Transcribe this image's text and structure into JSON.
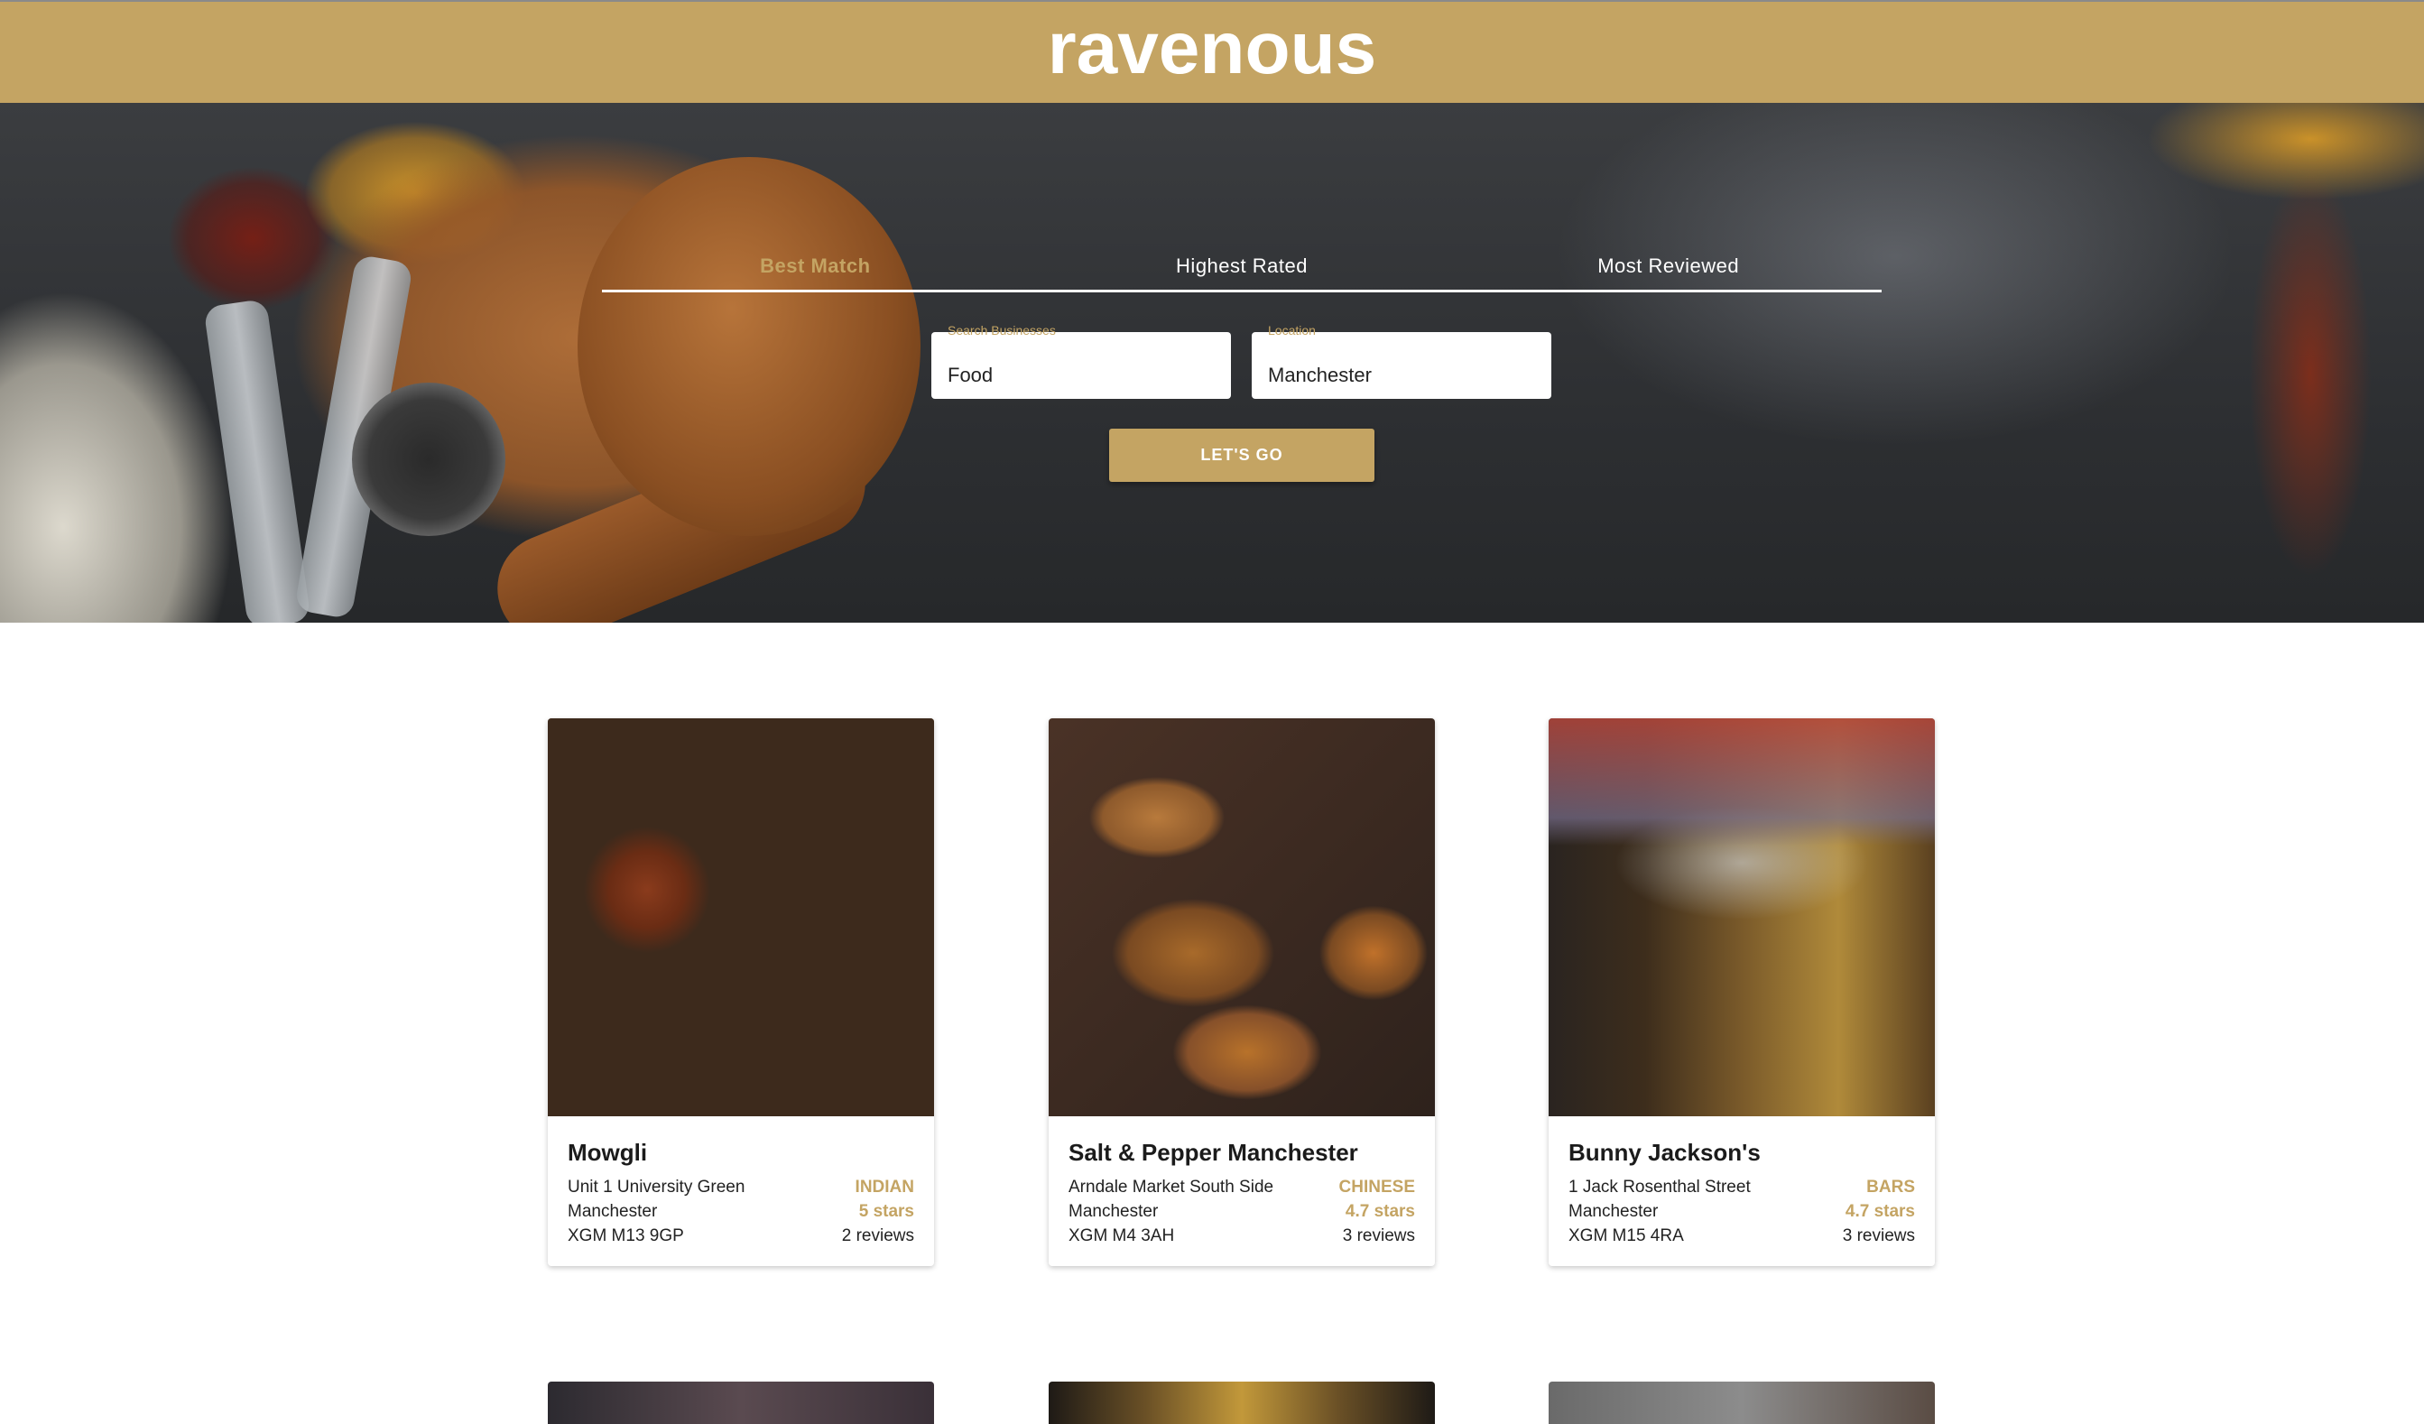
{
  "header": {
    "brand": "ravenous"
  },
  "search": {
    "tabs": [
      {
        "label": "Best Match",
        "active": true
      },
      {
        "label": "Highest Rated",
        "active": false
      },
      {
        "label": "Most Reviewed",
        "active": false
      }
    ],
    "term_label": "Search Businesses",
    "term_value": "Food",
    "location_label": "Location",
    "location_value": "Manchester",
    "submit_label": "LET'S GO"
  },
  "businesses": [
    {
      "name": "Mowgli",
      "address": "Unit 1 University Green",
      "city": "Manchester",
      "region": "XGM M13 9GP",
      "category": "INDIAN",
      "rating": "5 stars",
      "reviews": "2 reviews"
    },
    {
      "name": "Salt & Pepper Manchester",
      "address": "Arndale Market South Side",
      "city": "Manchester",
      "region": "XGM M4 3AH",
      "category": "CHINESE",
      "rating": "4.7 stars",
      "reviews": "3 reviews"
    },
    {
      "name": "Bunny Jackson's",
      "address": "1 Jack Rosenthal Street",
      "city": "Manchester",
      "region": "XGM M15 4RA",
      "category": "BARS",
      "rating": "4.7 stars",
      "reviews": "3 reviews"
    }
  ],
  "colors": {
    "accent": "#c4a463",
    "text": "#222222"
  }
}
